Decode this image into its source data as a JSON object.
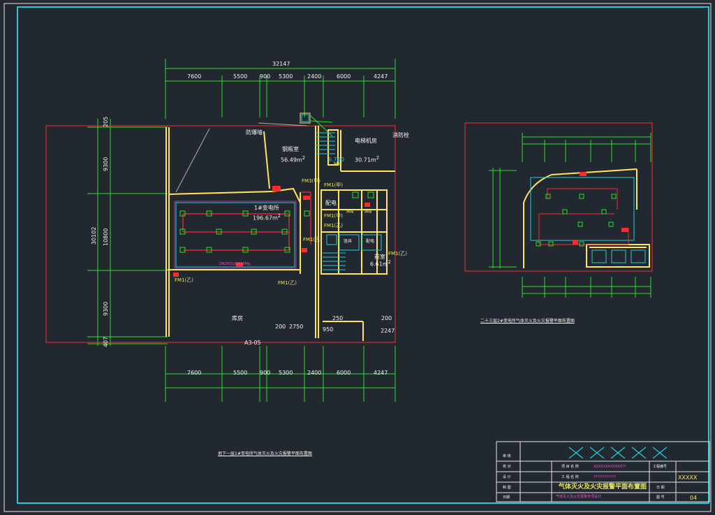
{
  "plan_left": {
    "top_total": "32147",
    "top_dims": [
      "7600",
      "5500",
      "900",
      "5300",
      "2400",
      "6000",
      "4247"
    ],
    "bottom_dims": [
      "7600",
      "5500",
      "900",
      "5300",
      "2400",
      "6000",
      "4247"
    ],
    "left_dims": [
      "205",
      "9300",
      "10800",
      "9300",
      "407"
    ],
    "left_total": "30102",
    "rooms": {
      "fanglouqi": "防爆墙",
      "gangping": "钢瓶室",
      "gangping_area": "56.49m",
      "dianti": "电梯机房",
      "dianti_area": "30.71m",
      "area_suffix": "2",
      "room_small": "6.700",
      "xiaoqiang": "消防栓",
      "biandian": "1#变电所",
      "biandian_area": "196.67m",
      "kufang": "库房",
      "shebei": "配电",
      "jingshi": "竖井",
      "peidian": "配电",
      "louti": "楼梯",
      "kuchuan": "前室",
      "kuchuan_area": "6.61m",
      "axis_label": "A3-05"
    },
    "fm_labels": [
      "FM3(甲)",
      "FM1(甲)",
      "FM1(甲)",
      "FM1(乙)",
      "FM1(乙)",
      "FM1(乙)",
      "FM1(乙)",
      "FM1(乙)"
    ],
    "m_labels": [
      "M4",
      "M4",
      "M4"
    ],
    "inner_dims": [
      "200",
      "2750",
      "950",
      "250",
      "200",
      "2247"
    ],
    "pipe_note": "DN25(S)/DN50Mg",
    "title": "地下一层1#变电所气体灭火及火灾报警平面布置图"
  },
  "plan_right": {
    "title": "二十三层2#变电所气体灭火及火灾报警平面布置图"
  },
  "title_block": {
    "xs": "✕✕✕✕✕",
    "rows": [
      "审 核",
      "校 对",
      "设 计",
      "制 图",
      "日期"
    ],
    "col2": [
      "项 目 名 称",
      "工 程 名 称",
      ""
    ],
    "val_project": "XXXXXXXXXXXX??",
    "val_name": "????????????",
    "sheet_title": "气体灭火及火灾报警平面布置图",
    "sub": "气体灭火及火灾报警专项设计",
    "right_labels": [
      "工程编号",
      "",
      "日 期",
      "图 号"
    ],
    "code": "XXXXX",
    "page": "04"
  },
  "colors": {
    "bg": "#212830",
    "frame": "#29c8d8",
    "green": "#2de02d",
    "red": "#ff2a2a",
    "yellow": "#ffe45c",
    "white": "#f2f2f2",
    "magenta": "#ff4dd8"
  }
}
